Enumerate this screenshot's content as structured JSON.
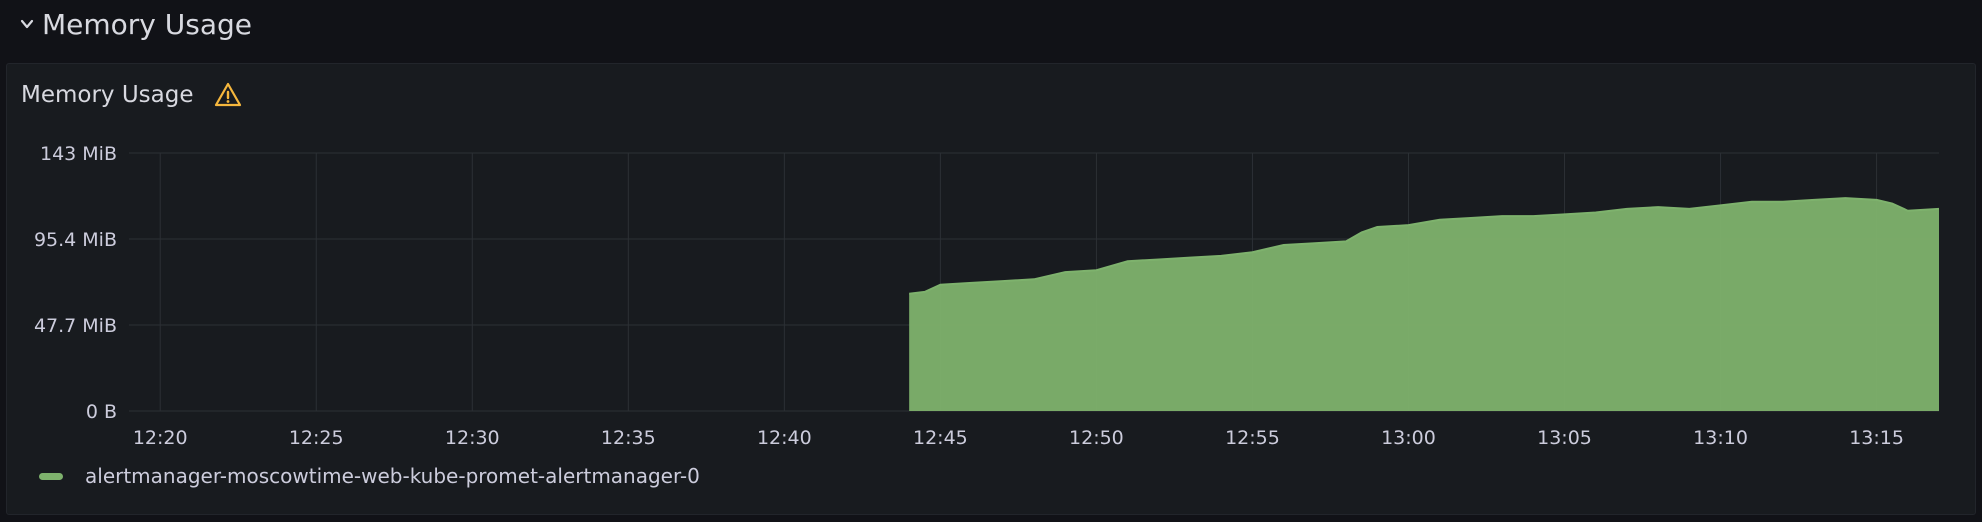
{
  "row": {
    "title": "Memory Usage",
    "icon": "chevron-down-icon"
  },
  "panel": {
    "title": "Memory Usage",
    "warning_icon": "warning-icon"
  },
  "colors": {
    "series": "#7eb26d",
    "grid": "#2c3035",
    "axis_text": "#ccccdc",
    "warning": "#f5b73d"
  },
  "chart_data": {
    "type": "area",
    "yticks": [
      "0 B",
      "47.7 MiB",
      "95.4 MiB",
      "143 MiB"
    ],
    "ylim_mib": [
      0,
      143
    ],
    "xticks": [
      "12:20",
      "12:25",
      "12:30",
      "12:35",
      "12:40",
      "12:45",
      "12:50",
      "12:55",
      "13:00",
      "13:05",
      "13:10",
      "13:15"
    ],
    "xlim": [
      "12:19",
      "13:17"
    ],
    "grid": true,
    "legend_position": "bottom-left",
    "series": [
      {
        "name": "alertmanager-moscowtime-web-kube-promet-alertmanager-0",
        "x": [
          "12:44",
          "12:44.5",
          "12:45",
          "12:46",
          "12:47",
          "12:48",
          "12:49",
          "12:50",
          "12:51",
          "12:52",
          "12:53",
          "12:54",
          "12:55",
          "12:56",
          "12:57",
          "12:58",
          "12:58.5",
          "12:59",
          "13:00",
          "13:01",
          "13:02",
          "13:03",
          "13:04",
          "13:05",
          "13:06",
          "13:07",
          "13:08",
          "13:09",
          "13:10",
          "13:11",
          "13:12",
          "13:13",
          "13:14",
          "13:15",
          "13:15.5",
          "13:16",
          "13:17"
        ],
        "y": [
          65,
          66,
          70,
          71,
          72,
          73,
          77,
          78,
          83,
          84,
          85,
          86,
          88,
          92,
          93,
          94,
          99,
          102,
          103,
          106,
          107,
          108,
          108,
          109,
          110,
          112,
          113,
          112,
          114,
          116,
          116,
          117,
          118,
          117,
          115,
          111,
          112
        ]
      }
    ]
  }
}
